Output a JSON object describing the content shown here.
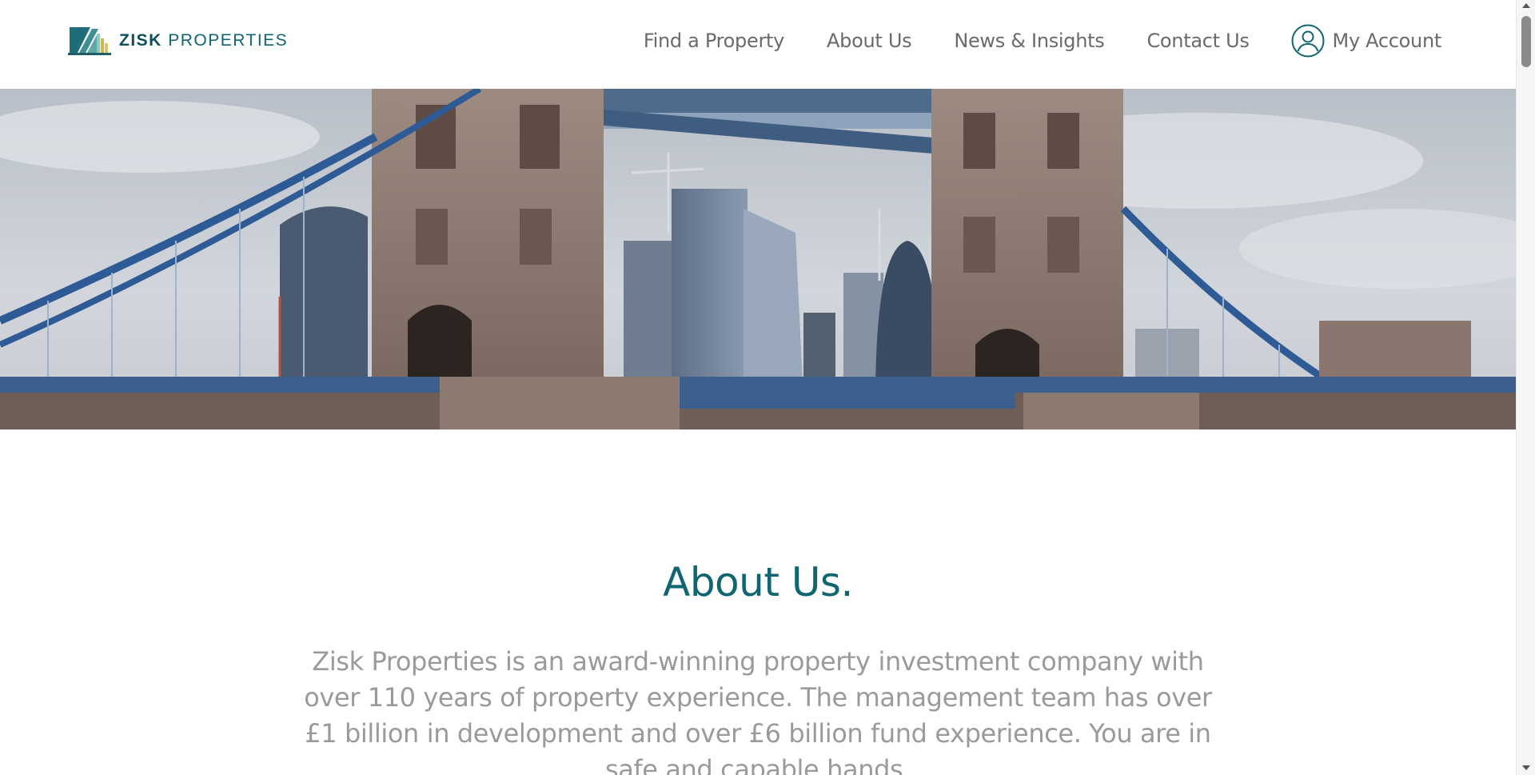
{
  "header": {
    "logo": {
      "brand_bold": "ZISK",
      "brand_light": "PROPERTIES"
    },
    "nav": [
      {
        "label": "Find a Property"
      },
      {
        "label": "About Us"
      },
      {
        "label": "News & Insights"
      },
      {
        "label": "Contact Us"
      }
    ],
    "account_label": "My Account",
    "account_icon": "user-circle-icon"
  },
  "hero": {
    "image_alt": "Tower Bridge with London skyline"
  },
  "about": {
    "title": "About Us.",
    "text": "Zisk Properties is an award-winning property investment company with over 110 years of property experience. The management team has over £1 billion in development and over £6 billion fund experience. You are in safe and capable hands."
  },
  "colors": {
    "brand": "#0f6670",
    "nav_text": "#6a6a6a",
    "body_text": "#9a9a9a"
  }
}
